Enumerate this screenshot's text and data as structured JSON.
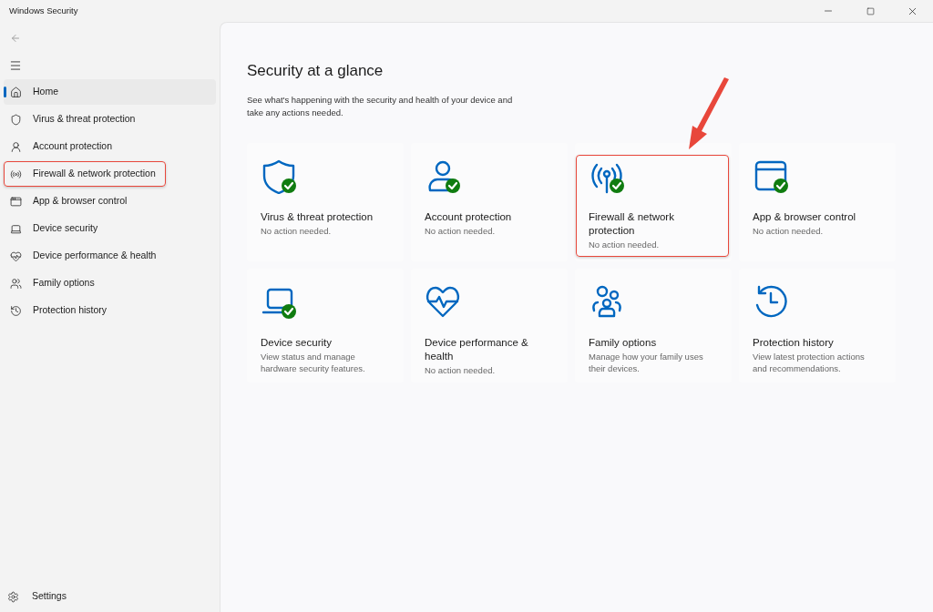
{
  "window": {
    "title": "Windows Security"
  },
  "sidebar": {
    "items": [
      {
        "label": "Home",
        "selected": true,
        "highlighted": false
      },
      {
        "label": "Virus & threat protection",
        "selected": false,
        "highlighted": false
      },
      {
        "label": "Account protection",
        "selected": false,
        "highlighted": false
      },
      {
        "label": "Firewall & network protection",
        "selected": false,
        "highlighted": true
      },
      {
        "label": "App & browser control",
        "selected": false,
        "highlighted": false
      },
      {
        "label": "Device security",
        "selected": false,
        "highlighted": false
      },
      {
        "label": "Device performance & health",
        "selected": false,
        "highlighted": false
      },
      {
        "label": "Family options",
        "selected": false,
        "highlighted": false
      },
      {
        "label": "Protection history",
        "selected": false,
        "highlighted": false
      }
    ],
    "settings": "Settings"
  },
  "main": {
    "title": "Security at a glance",
    "description": "See what's happening with the security and health of your device and take any actions needed.",
    "cards": [
      {
        "title": "Virus & threat protection",
        "status": "No action needed.",
        "ok": true,
        "highlighted": false
      },
      {
        "title": "Account protection",
        "status": "No action needed.",
        "ok": true,
        "highlighted": false
      },
      {
        "title": "Firewall & network protection",
        "status": "No action needed.",
        "ok": true,
        "highlighted": true
      },
      {
        "title": "App & browser control",
        "status": "No action needed.",
        "ok": true,
        "highlighted": false
      },
      {
        "title": "Device security",
        "status": "View status and manage hardware security features.",
        "ok": true,
        "highlighted": false
      },
      {
        "title": "Device performance & health",
        "status": "No action needed.",
        "ok": false,
        "highlighted": false
      },
      {
        "title": "Family options",
        "status": "Manage how your family uses their devices.",
        "ok": false,
        "highlighted": false
      },
      {
        "title": "Protection history",
        "status": "View latest protection actions and recommendations.",
        "ok": false,
        "highlighted": false
      }
    ]
  },
  "annotation": {
    "arrow": true
  }
}
